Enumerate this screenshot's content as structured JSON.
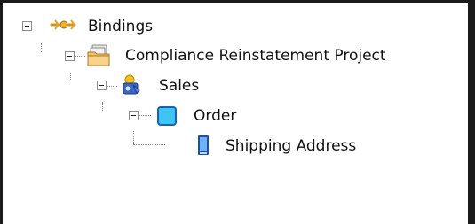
{
  "tree": {
    "nodes": [
      {
        "label": "Bindings",
        "icon": "bindings-icon",
        "expanded": true
      },
      {
        "label": "Compliance Reinstatement Project",
        "icon": "project-folder-icon",
        "expanded": true
      },
      {
        "label": "Sales",
        "icon": "service-icon",
        "expanded": true
      },
      {
        "label": "Order",
        "icon": "component-icon",
        "expanded": true
      },
      {
        "label": "Shipping Address",
        "icon": "element-icon",
        "expanded": false
      }
    ]
  },
  "colors": {
    "frame": "#1a1a1a",
    "connector": "#8a8a8a",
    "component_fill": "#3fc4f4",
    "element_fill": "#2f6fd6",
    "folder_fill": "#f2c06b"
  }
}
